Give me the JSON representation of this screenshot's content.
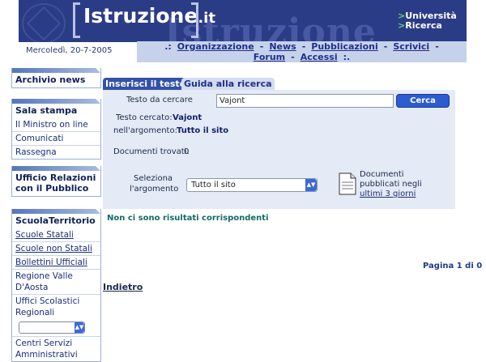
{
  "header": {
    "logo": "Istruzione",
    "logo_suffix": ".it",
    "watermark": "Istruzione",
    "universita": "Università",
    "ricerca": "Ricerca"
  },
  "date": "Mercoledì, 20-7-2005",
  "topnav": {
    "lead": ".:",
    "items": [
      "Organizzazione",
      "News",
      "Pubblicazioni",
      "Scrivici",
      "Forum",
      "Accessi"
    ],
    "sep": "-",
    "trail": ":."
  },
  "sidebar": {
    "archivio": "Archivio news",
    "sala_stampa": {
      "title": "Sala stampa",
      "items": [
        "Il Ministro on line",
        "Comunicati",
        "Rassegna"
      ]
    },
    "urp": "Ufficio Relazioni con il Pubblico",
    "scuola": {
      "title": "ScuolaTerritorio",
      "items": [
        "Scuole Statali",
        "Scuole non Statali",
        "Bollettini Ufficiali",
        "Regione Valle D'Aosta",
        "Uffici Scolastici Regionali"
      ],
      "after_select": "Centri Servizi Amministrativi"
    }
  },
  "tabs": {
    "insert": "Inserisci il testo",
    "guide": "Guida alla ricerca"
  },
  "search": {
    "label": "Testo da cercare",
    "value": "Vajont",
    "button": "Cerca",
    "searched_label": "Testo cercato:",
    "searched_value": "Vajont",
    "topic_label": "nell'argomento:",
    "topic_value": "Tutto il sito",
    "found_label": "Documenti trovati:",
    "found_value": "0",
    "select_label_1": "Seleziona",
    "select_label_2": "l'argomento",
    "select_value": "Tutto il sito"
  },
  "recent": {
    "line1": "Documenti",
    "line2": "pubblicati negli",
    "link": "ultimi 3 giorni"
  },
  "results": {
    "none": "Non ci sono risultati corrispondenti",
    "page": "Pagina 1 di 0",
    "back": "Indietro"
  }
}
